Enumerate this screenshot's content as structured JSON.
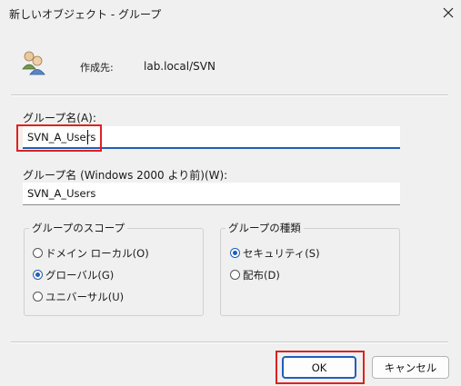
{
  "window": {
    "title": "新しいオブジェクト - グループ"
  },
  "header": {
    "owner_label": "作成先:",
    "owner_value": "lab.local/SVN"
  },
  "form": {
    "name_label": "グループ名(A):",
    "name_value": "SVN_A_Users",
    "pre2000_label": "グループ名 (Windows 2000 より前)(W):",
    "pre2000_value": "SVN_A_Users"
  },
  "scope": {
    "legend": "グループのスコープ",
    "options": [
      {
        "label": "ドメイン ローカル(O)",
        "checked": false
      },
      {
        "label": "グローバル(G)",
        "checked": true
      },
      {
        "label": "ユニバーサル(U)",
        "checked": false
      }
    ]
  },
  "type": {
    "legend": "グループの種類",
    "options": [
      {
        "label": "セキュリティ(S)",
        "checked": true
      },
      {
        "label": "配布(D)",
        "checked": false
      }
    ]
  },
  "buttons": {
    "ok": "OK",
    "cancel": "キャンセル"
  },
  "colors": {
    "accent": "#1f5fb9",
    "highlight": "#e02020",
    "background": "#f0f0f0"
  }
}
